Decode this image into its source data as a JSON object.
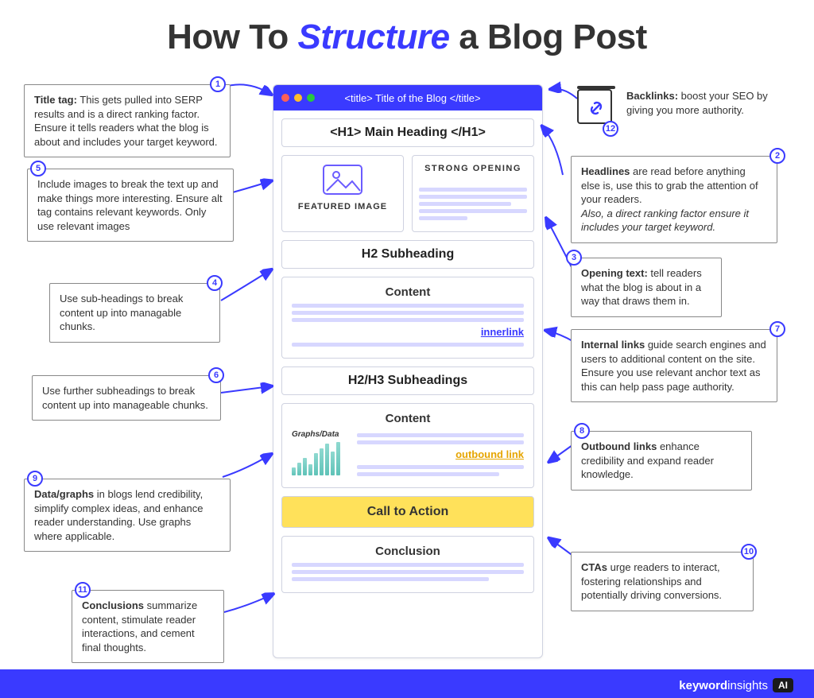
{
  "title": {
    "pre": "How To ",
    "accent": "Structure",
    "post": " a Blog Post"
  },
  "mock": {
    "titlebar": "<title> Title of the Blog </title>",
    "h1": "<H1> Main Heading </H1>",
    "featured_caption": "FEATURED IMAGE",
    "strong_opening": "STRONG OPENING",
    "h2_a": "H2 Subheading",
    "content_a_title": "Content",
    "innerlink": "innerlink",
    "h2h3": "H2/H3 Subheadings",
    "content_b_title": "Content",
    "graphs_label": "Graphs/Data",
    "outbound": "outbound link",
    "cta": "Call to Action",
    "conclusion": "Conclusion"
  },
  "tips": {
    "t1": {
      "bold": "Title tag:",
      "rest": " This gets pulled into SERP results and is a direct ranking factor. Ensure it tells  readers what the blog is about and includes your target keyword."
    },
    "t2": {
      "bold": "Headlines",
      "rest": " are read before anything else is, use this to grab the attention of your readers.",
      "italic": "Also, a direct ranking factor ensure it includes your target keyword."
    },
    "t3": {
      "bold": "Opening text:",
      "rest": " tell readers what the blog is about in a way that draws them in."
    },
    "t4": {
      "rest": "Use sub-headings to break content up into managable chunks."
    },
    "t5": {
      "rest": "Include images to break the text up and make things more interesting. Ensure alt tag contains relevant keywords.  Only use relevant images"
    },
    "t6": {
      "rest": "Use further subheadings to break content up into manageable chunks."
    },
    "t7": {
      "bold": "Internal links",
      "rest": " guide search engines and users to additional content on the site. Ensure you use relevant anchor text as this can help pass page authority."
    },
    "t8": {
      "bold": "Outbound links",
      "rest": " enhance credibility and expand reader knowledge."
    },
    "t9": {
      "bold": "Data/graphs",
      "rest": " in blogs lend credibility, simplify complex ideas, and enhance reader understanding. Use graphs where applicable."
    },
    "t10": {
      "bold": "CTAs",
      "rest": " urge readers to interact, fostering  relationships and potentially driving conversions."
    },
    "t11": {
      "bold": "Conclusions",
      "rest": " summarize content, stimulate reader interactions, and cement final thoughts."
    },
    "t12": {
      "bold": "Backlinks:",
      "rest": " boost your SEO by giving you more authority."
    }
  },
  "nums": {
    "n1": "1",
    "n2": "2",
    "n3": "3",
    "n4": "4",
    "n5": "5",
    "n6": "6",
    "n7": "7",
    "n8": "8",
    "n9": "9",
    "n10": "10",
    "n11": "11",
    "n12": "12"
  },
  "brand": {
    "a": "keyword",
    "b": "insights",
    "ai": "AI"
  }
}
